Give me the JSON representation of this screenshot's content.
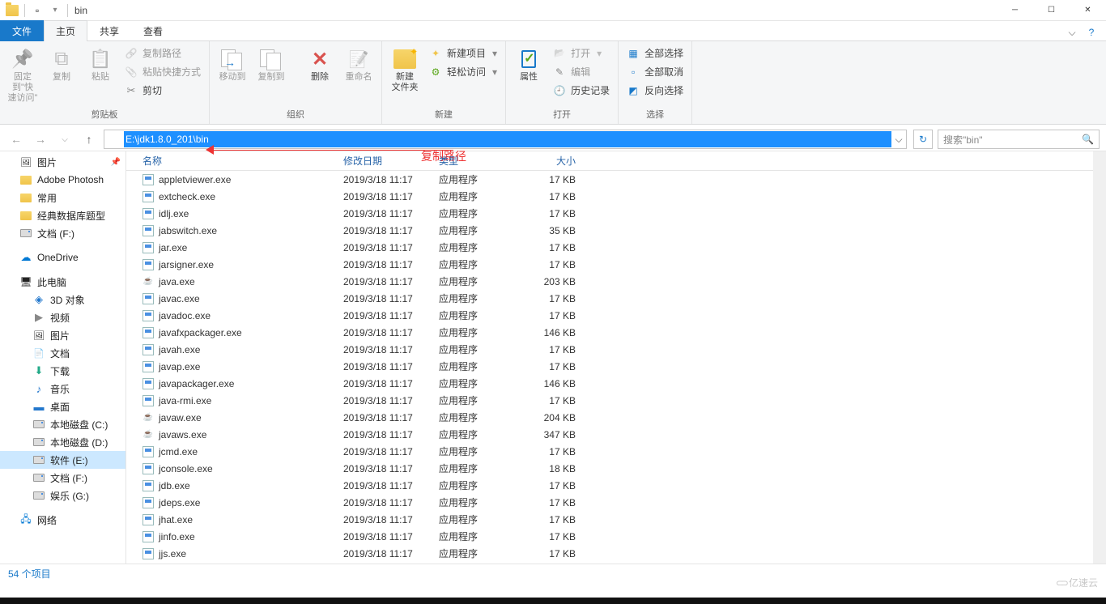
{
  "titlebar": {
    "title": "bin"
  },
  "tabs": {
    "file": "文件",
    "home": "主页",
    "share": "共享",
    "view": "查看"
  },
  "ribbon": {
    "clipboard": {
      "pin": "固定到\"快\n速访问\"",
      "copy": "复制",
      "paste": "粘贴",
      "copy_path": "复制路径",
      "paste_shortcut": "粘贴快捷方式",
      "cut": "剪切",
      "group": "剪贴板"
    },
    "organize": {
      "move_to": "移动到",
      "copy_to": "复制到",
      "delete": "删除",
      "rename": "重命名",
      "group": "组织"
    },
    "new": {
      "new_folder": "新建\n文件夹",
      "new_item": "新建项目",
      "easy_access": "轻松访问",
      "group": "新建"
    },
    "open": {
      "properties": "属性",
      "open": "打开",
      "edit": "编辑",
      "history": "历史记录",
      "group": "打开"
    },
    "select": {
      "select_all": "全部选择",
      "select_none": "全部取消",
      "invert": "反向选择",
      "group": "选择"
    }
  },
  "address": {
    "path": "E:\\jdk1.8.0_201\\bin"
  },
  "search": {
    "placeholder": "搜索\"bin\""
  },
  "annotation": "复制路径",
  "columns": {
    "name": "名称",
    "date": "修改日期",
    "type": "类型",
    "size": "大小"
  },
  "sidebar": [
    {
      "label": "图片",
      "ico": "sb-pic",
      "pin": true
    },
    {
      "label": "Adobe Photosh",
      "ico": "folder"
    },
    {
      "label": "常用",
      "ico": "folder"
    },
    {
      "label": "经典数据库题型",
      "ico": "folder"
    },
    {
      "label": "文档 (F:)",
      "ico": "drive"
    },
    {
      "spacer": true
    },
    {
      "label": "OneDrive",
      "ico": "sb-onedrive"
    },
    {
      "spacer": true
    },
    {
      "label": "此电脑",
      "ico": "sb-pc"
    },
    {
      "label": "3D 对象",
      "ico": "sb-3d",
      "l2": true
    },
    {
      "label": "视频",
      "ico": "sb-vid",
      "l2": true
    },
    {
      "label": "图片",
      "ico": "sb-pic",
      "l2": true
    },
    {
      "label": "文档",
      "ico": "sb-doc",
      "l2": true
    },
    {
      "label": "下载",
      "ico": "sb-dl",
      "l2": true
    },
    {
      "label": "音乐",
      "ico": "sb-music",
      "l2": true
    },
    {
      "label": "桌面",
      "ico": "sb-desk",
      "l2": true
    },
    {
      "label": "本地磁盘 (C:)",
      "ico": "drive",
      "l2": true
    },
    {
      "label": "本地磁盘 (D:)",
      "ico": "drive",
      "l2": true
    },
    {
      "label": "软件 (E:)",
      "ico": "drive",
      "l2": true,
      "sel": true
    },
    {
      "label": "文档 (F:)",
      "ico": "drive",
      "l2": true
    },
    {
      "label": "娱乐 (G:)",
      "ico": "drive",
      "l2": true
    },
    {
      "spacer": true
    },
    {
      "label": "网络",
      "ico": "sb-net"
    }
  ],
  "files": [
    {
      "name": "appletviewer.exe",
      "date": "2019/3/18 11:17",
      "type": "应用程序",
      "size": "17 KB",
      "ico": "exe"
    },
    {
      "name": "extcheck.exe",
      "date": "2019/3/18 11:17",
      "type": "应用程序",
      "size": "17 KB",
      "ico": "exe"
    },
    {
      "name": "idlj.exe",
      "date": "2019/3/18 11:17",
      "type": "应用程序",
      "size": "17 KB",
      "ico": "exe"
    },
    {
      "name": "jabswitch.exe",
      "date": "2019/3/18 11:17",
      "type": "应用程序",
      "size": "35 KB",
      "ico": "exe"
    },
    {
      "name": "jar.exe",
      "date": "2019/3/18 11:17",
      "type": "应用程序",
      "size": "17 KB",
      "ico": "exe"
    },
    {
      "name": "jarsigner.exe",
      "date": "2019/3/18 11:17",
      "type": "应用程序",
      "size": "17 KB",
      "ico": "exe"
    },
    {
      "name": "java.exe",
      "date": "2019/3/18 11:17",
      "type": "应用程序",
      "size": "203 KB",
      "ico": "java"
    },
    {
      "name": "javac.exe",
      "date": "2019/3/18 11:17",
      "type": "应用程序",
      "size": "17 KB",
      "ico": "exe"
    },
    {
      "name": "javadoc.exe",
      "date": "2019/3/18 11:17",
      "type": "应用程序",
      "size": "17 KB",
      "ico": "exe"
    },
    {
      "name": "javafxpackager.exe",
      "date": "2019/3/18 11:17",
      "type": "应用程序",
      "size": "146 KB",
      "ico": "exe"
    },
    {
      "name": "javah.exe",
      "date": "2019/3/18 11:17",
      "type": "应用程序",
      "size": "17 KB",
      "ico": "exe"
    },
    {
      "name": "javap.exe",
      "date": "2019/3/18 11:17",
      "type": "应用程序",
      "size": "17 KB",
      "ico": "exe"
    },
    {
      "name": "javapackager.exe",
      "date": "2019/3/18 11:17",
      "type": "应用程序",
      "size": "146 KB",
      "ico": "exe"
    },
    {
      "name": "java-rmi.exe",
      "date": "2019/3/18 11:17",
      "type": "应用程序",
      "size": "17 KB",
      "ico": "exe"
    },
    {
      "name": "javaw.exe",
      "date": "2019/3/18 11:17",
      "type": "应用程序",
      "size": "204 KB",
      "ico": "java"
    },
    {
      "name": "javaws.exe",
      "date": "2019/3/18 11:17",
      "type": "应用程序",
      "size": "347 KB",
      "ico": "java"
    },
    {
      "name": "jcmd.exe",
      "date": "2019/3/18 11:17",
      "type": "应用程序",
      "size": "17 KB",
      "ico": "exe"
    },
    {
      "name": "jconsole.exe",
      "date": "2019/3/18 11:17",
      "type": "应用程序",
      "size": "18 KB",
      "ico": "exe"
    },
    {
      "name": "jdb.exe",
      "date": "2019/3/18 11:17",
      "type": "应用程序",
      "size": "17 KB",
      "ico": "exe"
    },
    {
      "name": "jdeps.exe",
      "date": "2019/3/18 11:17",
      "type": "应用程序",
      "size": "17 KB",
      "ico": "exe"
    },
    {
      "name": "jhat.exe",
      "date": "2019/3/18 11:17",
      "type": "应用程序",
      "size": "17 KB",
      "ico": "exe"
    },
    {
      "name": "jinfo.exe",
      "date": "2019/3/18 11:17",
      "type": "应用程序",
      "size": "17 KB",
      "ico": "exe"
    },
    {
      "name": "jjs.exe",
      "date": "2019/3/18 11:17",
      "type": "应用程序",
      "size": "17 KB",
      "ico": "exe"
    }
  ],
  "status": {
    "items": "54 个项目"
  },
  "watermark": "亿速云"
}
